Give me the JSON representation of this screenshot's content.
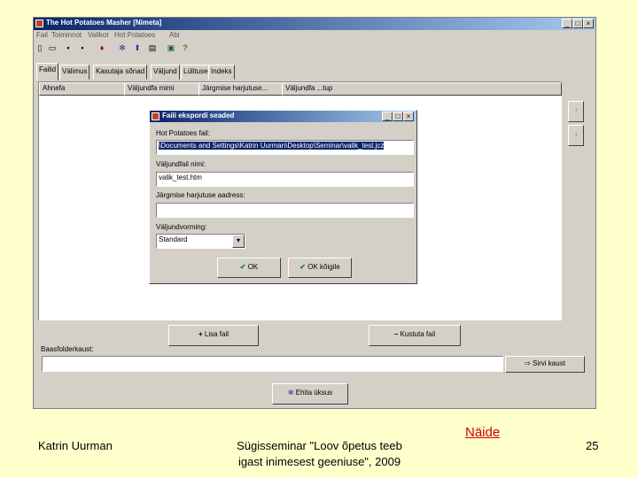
{
  "window": {
    "title": "The Hot Potatoes Masher [Nimeta]",
    "controls": [
      "_",
      "□",
      "×"
    ]
  },
  "menu": [
    "Fail",
    "Toiminnot",
    "Valikot",
    "Hot Potatoes",
    "Abi"
  ],
  "toolbar_icons": [
    "new-icon",
    "open-icon",
    "save-icon",
    "save-as-icon",
    "remove-icon",
    "masher-icon",
    "upload-icon",
    "page-icon",
    "help-book-icon",
    "help-icon"
  ],
  "tabs": [
    "Failid",
    "Välimus",
    "Kasutaja sõnad",
    "Väljund",
    "Lülitused",
    "Indeks"
  ],
  "list": {
    "columns": [
      "Ahnefa",
      "Väljundfa mimi",
      "Järgmise harjutuse...",
      "Väljundfa ...tup"
    ]
  },
  "side_buttons": [
    "↑",
    "↓"
  ],
  "buttons": {
    "add": "Lisa fail",
    "remove": "Kustuta fail",
    "browse": "Sirvi kaust",
    "build": "Ehita üksus"
  },
  "base_folder_label": "Baasfolderkaust:",
  "base_folder_value": "",
  "dialog": {
    "title": "Faili ekspordi seaded",
    "hp_file_label": "Hot Potatoes fail:",
    "hp_file_value": "\\Documents and Settings\\Katrin Uurman\\Desktop\\Seminar\\valik_test.jcz",
    "output_label": "Väljundfail nimi:",
    "output_value": "valik_test.htm",
    "next_label": "Järgmise harjutuse aadress:",
    "next_value": "",
    "format_label": "Väljundvorming:",
    "format_value": "Standard",
    "ok": "OK",
    "ok_all": "OK kõigile"
  },
  "footer": {
    "author": "Katrin Uurman",
    "event_line1": "Sügisseminar \"Loov õpetus teeb",
    "event_line2": "igast inimesest geeniuse\", 2009",
    "link": "Näide",
    "page": "25"
  },
  "colors": {
    "slide_bg": "#ffffcc",
    "window_bg": "#d4d0c8",
    "title_start": "#0a246a",
    "title_end": "#a6caf0",
    "link": "#cc0000"
  }
}
